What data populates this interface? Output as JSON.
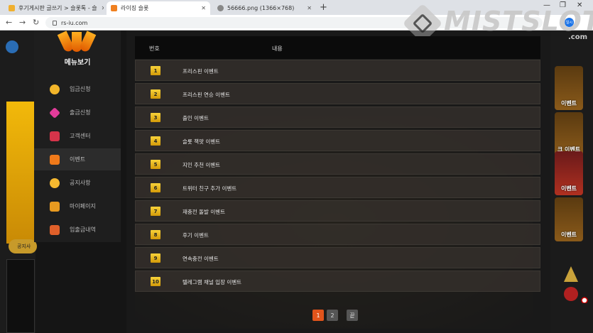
{
  "browser": {
    "tabs": [
      {
        "title": "후기게시판 글쓰기 > 슬롯톡 - 슬",
        "active": false
      },
      {
        "title": "라이징 슬롯",
        "active": true
      },
      {
        "title": "56666.png (1366×768)",
        "active": false
      }
    ],
    "url": "rs-iu.com",
    "new_tab": "+",
    "profile": "일시"
  },
  "watermark": {
    "text": "MISTSLOT",
    "suffix": ".com"
  },
  "sidebar": {
    "title": "메뉴보기",
    "items": [
      {
        "label": "입금신청",
        "icon": "coin-icon",
        "color": "#f2b52a"
      },
      {
        "label": "출금신청",
        "icon": "gem-icon",
        "color": "#e23c9a"
      },
      {
        "label": "고객센터",
        "icon": "headset-icon",
        "color": "#d6344a"
      },
      {
        "label": "이벤트",
        "icon": "gift-icon",
        "color": "#f07a1a",
        "active": true
      },
      {
        "label": "공지사항",
        "icon": "balloon-icon",
        "color": "#f5b830"
      },
      {
        "label": "마이페이지",
        "icon": "crown-icon",
        "color": "#e89a20"
      },
      {
        "label": "입출금내역",
        "icon": "box-icon",
        "color": "#e0602a"
      }
    ]
  },
  "table": {
    "headers": {
      "no": "번호",
      "content": "내용"
    },
    "rows": [
      {
        "no": "1",
        "title": "프리스핀 이벤트"
      },
      {
        "no": "2",
        "title": "프리스핀 연승 이벤트"
      },
      {
        "no": "3",
        "title": "출인 이벤트"
      },
      {
        "no": "4",
        "title": "슬롯 책팟 이벤트"
      },
      {
        "no": "5",
        "title": "지인 추천 이벤트"
      },
      {
        "no": "6",
        "title": "트위터 친구 추가 이벤트"
      },
      {
        "no": "7",
        "title": "재충전 돌발 이벤트"
      },
      {
        "no": "8",
        "title": "후기 이벤트"
      },
      {
        "no": "9",
        "title": "연속충전 이벤트"
      },
      {
        "no": "10",
        "title": "텔레그램 채널 입장 이벤트"
      }
    ]
  },
  "pagination": {
    "pages": [
      "1",
      "2"
    ],
    "last": "끝",
    "current": "1"
  },
  "right_promos": [
    {
      "label": "이벤트"
    },
    {
      "label": "크 이벤트"
    },
    {
      "label": "이벤트"
    },
    {
      "label": "이벤트"
    }
  ],
  "left_notice": "공지사"
}
